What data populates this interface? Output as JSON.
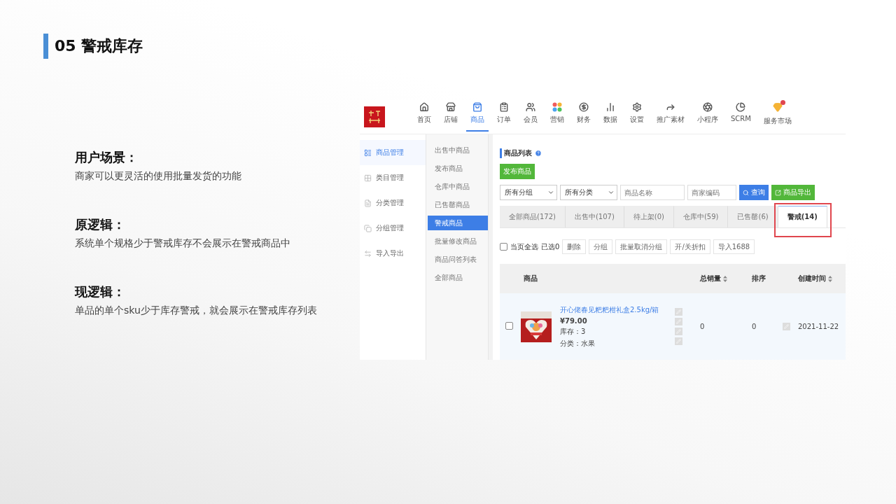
{
  "slide": {
    "number": "05",
    "title": "警戒库存"
  },
  "sections": [
    {
      "heading": "用户场景：",
      "body": "商家可以更灵活的使用批量发货的功能"
    },
    {
      "heading": "原逻辑：",
      "body": "系统单个规格少于警戒库存不会展示在警戒商品中"
    },
    {
      "heading": "现逻辑：",
      "body": "单品的单个sku少于库存警戒，就会展示在警戒库存列表"
    }
  ],
  "app": {
    "nav": [
      {
        "label": "首页",
        "selected": false
      },
      {
        "label": "店铺",
        "selected": false
      },
      {
        "label": "商品",
        "selected": true
      },
      {
        "label": "订单",
        "selected": false
      },
      {
        "label": "会员",
        "selected": false
      },
      {
        "label": "营销",
        "selected": false
      },
      {
        "label": "财务",
        "selected": false
      },
      {
        "label": "数据",
        "selected": false
      },
      {
        "label": "设置",
        "selected": false
      },
      {
        "label": "推广素材",
        "selected": false
      },
      {
        "label": "小程序",
        "selected": false
      },
      {
        "label": "SCRM",
        "selected": false
      },
      {
        "label": "服务市场",
        "selected": false
      }
    ],
    "sidebar": [
      {
        "label": "商品管理",
        "selected": true
      },
      {
        "label": "类目管理",
        "selected": false
      },
      {
        "label": "分类管理",
        "selected": false
      },
      {
        "label": "分组管理",
        "selected": false
      },
      {
        "label": "导入导出",
        "selected": false
      }
    ],
    "submenu": [
      {
        "label": "出售中商品",
        "selected": false
      },
      {
        "label": "发布商品",
        "selected": false
      },
      {
        "label": "仓库中商品",
        "selected": false
      },
      {
        "label": "已售罄商品",
        "selected": false
      },
      {
        "label": "警戒商品",
        "selected": true
      },
      {
        "label": "批量修改商品",
        "selected": false
      },
      {
        "label": "商品问答列表",
        "selected": false
      },
      {
        "label": "全部商品",
        "selected": false
      }
    ],
    "list_title": "商品列表",
    "publish_button": "发布商品",
    "filters": {
      "group_select": "所有分组",
      "category_select": "所有分类",
      "name_placeholder": "商品名称",
      "code_placeholder": "商家编码",
      "search_button": "查询",
      "export_button": "商品导出"
    },
    "tabs": [
      {
        "label": "全部商品(172)",
        "selected": false,
        "highlighted": false
      },
      {
        "label": "出售中(107)",
        "selected": false,
        "highlighted": false
      },
      {
        "label": "待上架(0)",
        "selected": false,
        "highlighted": false
      },
      {
        "label": "仓库中(59)",
        "selected": false,
        "highlighted": false
      },
      {
        "label": "已售罄(6)",
        "selected": false,
        "highlighted": false
      },
      {
        "label": "警戒(14)",
        "selected": true,
        "highlighted": true
      }
    ],
    "bulk": {
      "select_all": "当页全选",
      "checked": false,
      "selected_count": "已选0",
      "actions": [
        "删除",
        "分组",
        "批量取消分组",
        "开/关折扣",
        "导入1688"
      ]
    },
    "table": {
      "columns": [
        {
          "label": "商品",
          "sortable": false
        },
        {
          "label": "总销量",
          "sortable": true
        },
        {
          "label": "排序",
          "sortable": false
        },
        {
          "label": "创建时间",
          "sortable": true
        }
      ],
      "rows": [
        {
          "checked": false,
          "title": "开心佬春见粑粑柑礼盒2.5kg/箱",
          "price": "¥79.00",
          "stock": "库存：3",
          "category": "分类：水果",
          "sales": "0",
          "sort": "0",
          "created": "2021-11-22"
        }
      ]
    }
  }
}
